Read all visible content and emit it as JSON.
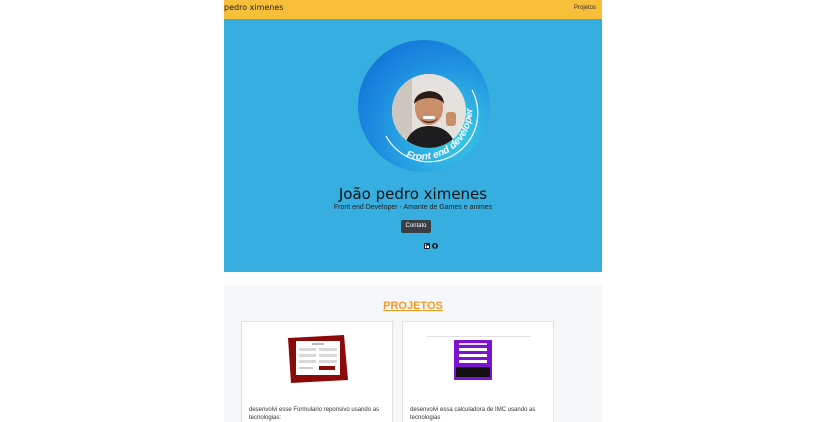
{
  "navbar": {
    "brand": "pedro ximenes",
    "link": "Projetos",
    "color": "#f8bf3b"
  },
  "hero": {
    "ring_text": "Front end developer",
    "name": "João pedro ximenes",
    "subtitle": "Front end Developer - Amante de Games e animes",
    "button": "Contato",
    "socials": [
      "linkedin-icon",
      "github-icon"
    ],
    "color": "#37aee0"
  },
  "projects": {
    "title": "PROJETOS",
    "cards": [
      {
        "text": "desenvolvi esse Formulario reponsivo usando as tecnologias:"
      },
      {
        "text": "desenvolvi essa calculadora de IMC usando as tecnologias"
      }
    ]
  }
}
